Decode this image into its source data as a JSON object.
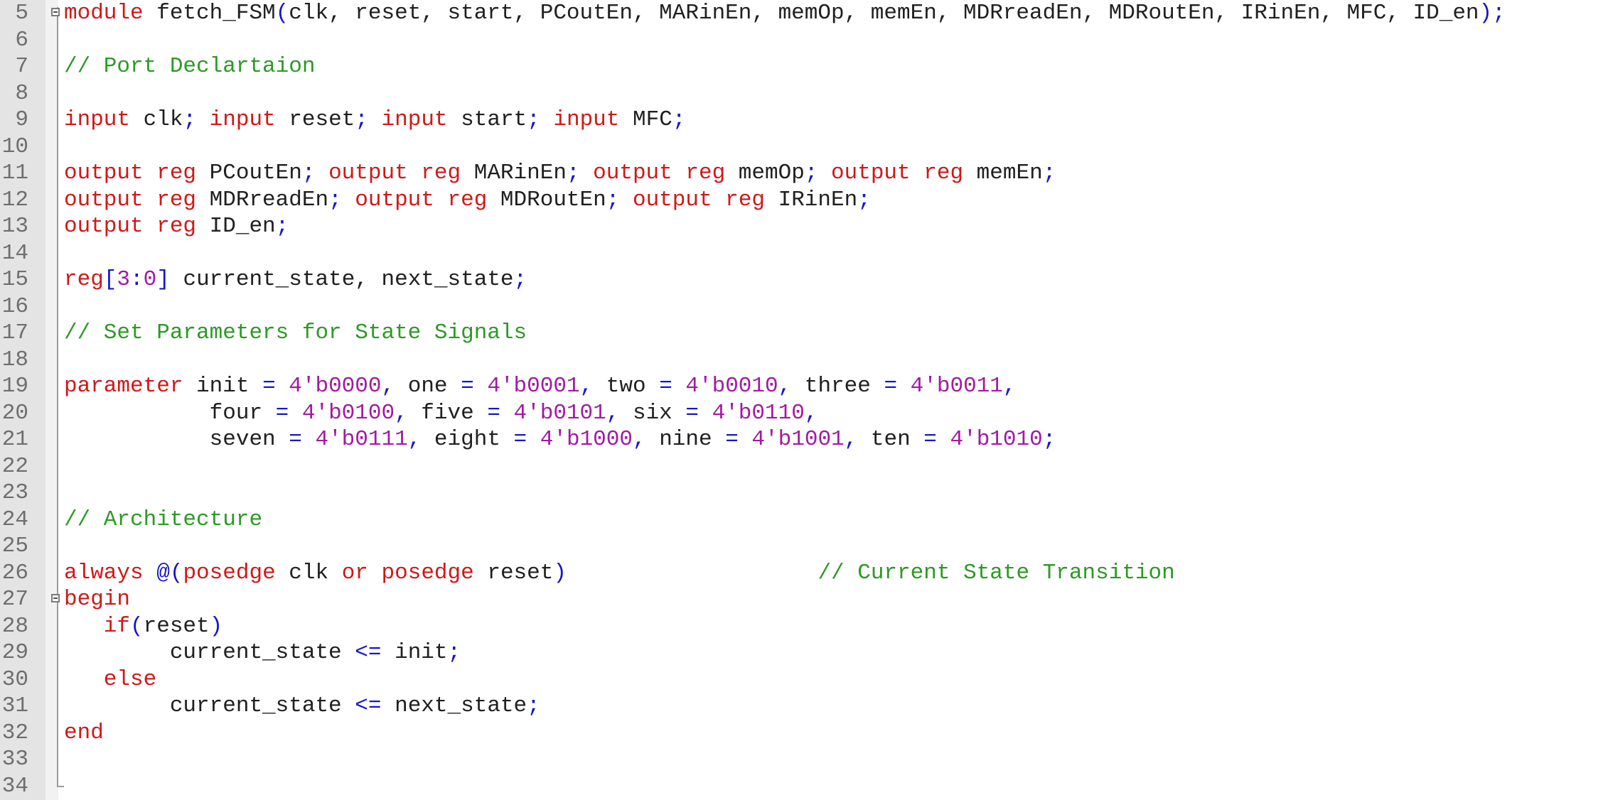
{
  "editor": {
    "language": "verilog",
    "lines": [
      {
        "n": "5",
        "fold": "open",
        "tokens": [
          {
            "t": "module",
            "c": "kw"
          },
          {
            "t": " fetch_FSM",
            "c": "id"
          },
          {
            "t": "(",
            "c": "op"
          },
          {
            "t": "clk, reset, start, PCoutEn, MARinEn, memOp, memEn, MDRreadEn, MDRoutEn, IRinEn, MFC, ID_en",
            "c": "id"
          },
          {
            "t": ");",
            "c": "op"
          }
        ]
      },
      {
        "n": "6",
        "tokens": []
      },
      {
        "n": "7",
        "tokens": [
          {
            "t": "// Port Declartaion",
            "c": "cm"
          }
        ]
      },
      {
        "n": "8",
        "tokens": []
      },
      {
        "n": "9",
        "tokens": [
          {
            "t": "input",
            "c": "kw"
          },
          {
            "t": " clk",
            "c": "id"
          },
          {
            "t": ";",
            "c": "op"
          },
          {
            "t": " input",
            "c": "kw"
          },
          {
            "t": " reset",
            "c": "id"
          },
          {
            "t": ";",
            "c": "op"
          },
          {
            "t": " input",
            "c": "kw"
          },
          {
            "t": " start",
            "c": "id"
          },
          {
            "t": ";",
            "c": "op"
          },
          {
            "t": " input",
            "c": "kw"
          },
          {
            "t": " MFC",
            "c": "id"
          },
          {
            "t": ";",
            "c": "op"
          }
        ]
      },
      {
        "n": "10",
        "tokens": []
      },
      {
        "n": "11",
        "tokens": [
          {
            "t": "output reg",
            "c": "kw"
          },
          {
            "t": " PCoutEn",
            "c": "id"
          },
          {
            "t": ";",
            "c": "op"
          },
          {
            "t": " output reg",
            "c": "kw"
          },
          {
            "t": " MARinEn",
            "c": "id"
          },
          {
            "t": ";",
            "c": "op"
          },
          {
            "t": " output reg",
            "c": "kw"
          },
          {
            "t": " memOp",
            "c": "id"
          },
          {
            "t": ";",
            "c": "op"
          },
          {
            "t": " output reg",
            "c": "kw"
          },
          {
            "t": " memEn",
            "c": "id"
          },
          {
            "t": ";",
            "c": "op"
          }
        ]
      },
      {
        "n": "12",
        "tokens": [
          {
            "t": "output reg",
            "c": "kw"
          },
          {
            "t": " MDRreadEn",
            "c": "id"
          },
          {
            "t": ";",
            "c": "op"
          },
          {
            "t": " output reg",
            "c": "kw"
          },
          {
            "t": " MDRoutEn",
            "c": "id"
          },
          {
            "t": ";",
            "c": "op"
          },
          {
            "t": " output reg",
            "c": "kw"
          },
          {
            "t": " IRinEn",
            "c": "id"
          },
          {
            "t": ";",
            "c": "op"
          }
        ]
      },
      {
        "n": "13",
        "tokens": [
          {
            "t": "output reg",
            "c": "kw"
          },
          {
            "t": " ID_en",
            "c": "id"
          },
          {
            "t": ";",
            "c": "op"
          }
        ]
      },
      {
        "n": "14",
        "tokens": []
      },
      {
        "n": "15",
        "tokens": [
          {
            "t": "reg",
            "c": "kw"
          },
          {
            "t": "[",
            "c": "op"
          },
          {
            "t": "3",
            "c": "num"
          },
          {
            "t": ":",
            "c": "op"
          },
          {
            "t": "0",
            "c": "num"
          },
          {
            "t": "]",
            "c": "op"
          },
          {
            "t": " current_state, next_state",
            "c": "id"
          },
          {
            "t": ";",
            "c": "op"
          }
        ]
      },
      {
        "n": "16",
        "tokens": []
      },
      {
        "n": "17",
        "tokens": [
          {
            "t": "// Set Parameters for State Signals",
            "c": "cm"
          }
        ]
      },
      {
        "n": "18",
        "tokens": []
      },
      {
        "n": "19",
        "tokens": [
          {
            "t": "parameter",
            "c": "kw"
          },
          {
            "t": " init ",
            "c": "id"
          },
          {
            "t": "=",
            "c": "op"
          },
          {
            "t": " 4'b0000",
            "c": "num"
          },
          {
            "t": ",",
            "c": "op"
          },
          {
            "t": " one ",
            "c": "id"
          },
          {
            "t": "=",
            "c": "op"
          },
          {
            "t": " 4'b0001",
            "c": "num"
          },
          {
            "t": ",",
            "c": "op"
          },
          {
            "t": " two ",
            "c": "id"
          },
          {
            "t": "=",
            "c": "op"
          },
          {
            "t": " 4'b0010",
            "c": "num"
          },
          {
            "t": ",",
            "c": "op"
          },
          {
            "t": " three ",
            "c": "id"
          },
          {
            "t": "=",
            "c": "op"
          },
          {
            "t": " 4'b0011",
            "c": "num"
          },
          {
            "t": ",",
            "c": "op"
          }
        ]
      },
      {
        "n": "20",
        "tokens": [
          {
            "t": "           four ",
            "c": "id"
          },
          {
            "t": "=",
            "c": "op"
          },
          {
            "t": " 4'b0100",
            "c": "num"
          },
          {
            "t": ",",
            "c": "op"
          },
          {
            "t": " five ",
            "c": "id"
          },
          {
            "t": "=",
            "c": "op"
          },
          {
            "t": " 4'b0101",
            "c": "num"
          },
          {
            "t": ",",
            "c": "op"
          },
          {
            "t": " six ",
            "c": "id"
          },
          {
            "t": "=",
            "c": "op"
          },
          {
            "t": " 4'b0110",
            "c": "num"
          },
          {
            "t": ",",
            "c": "op"
          }
        ]
      },
      {
        "n": "21",
        "tokens": [
          {
            "t": "           seven ",
            "c": "id"
          },
          {
            "t": "=",
            "c": "op"
          },
          {
            "t": " 4'b0111",
            "c": "num"
          },
          {
            "t": ",",
            "c": "op"
          },
          {
            "t": " eight ",
            "c": "id"
          },
          {
            "t": "=",
            "c": "op"
          },
          {
            "t": " 4'b1000",
            "c": "num"
          },
          {
            "t": ",",
            "c": "op"
          },
          {
            "t": " nine ",
            "c": "id"
          },
          {
            "t": "=",
            "c": "op"
          },
          {
            "t": " 4'b1001",
            "c": "num"
          },
          {
            "t": ",",
            "c": "op"
          },
          {
            "t": " ten ",
            "c": "id"
          },
          {
            "t": "=",
            "c": "op"
          },
          {
            "t": " 4'b1010",
            "c": "num"
          },
          {
            "t": ";",
            "c": "op"
          }
        ]
      },
      {
        "n": "22",
        "tokens": []
      },
      {
        "n": "23",
        "tokens": []
      },
      {
        "n": "24",
        "tokens": [
          {
            "t": "// Architecture",
            "c": "cm"
          }
        ]
      },
      {
        "n": "25",
        "tokens": []
      },
      {
        "n": "26",
        "tokens": [
          {
            "t": "always",
            "c": "kw"
          },
          {
            "t": " @",
            "c": "op"
          },
          {
            "t": "(",
            "c": "op"
          },
          {
            "t": "posedge",
            "c": "kw"
          },
          {
            "t": " clk ",
            "c": "id"
          },
          {
            "t": "or",
            "c": "kw"
          },
          {
            "t": " posedge",
            "c": "kw"
          },
          {
            "t": " reset",
            "c": "id"
          },
          {
            "t": ")",
            "c": "op"
          },
          {
            "t": "                   ",
            "c": "id"
          },
          {
            "t": "// Current State Transition",
            "c": "cm"
          }
        ]
      },
      {
        "n": "27",
        "fold": "open",
        "tokens": [
          {
            "t": "begin",
            "c": "kw"
          }
        ]
      },
      {
        "n": "28",
        "tokens": [
          {
            "t": "   if",
            "c": "kw"
          },
          {
            "t": "(",
            "c": "op"
          },
          {
            "t": "reset",
            "c": "id"
          },
          {
            "t": ")",
            "c": "op"
          }
        ]
      },
      {
        "n": "29",
        "tokens": [
          {
            "t": "        current_state ",
            "c": "id"
          },
          {
            "t": "<=",
            "c": "op"
          },
          {
            "t": " init",
            "c": "id"
          },
          {
            "t": ";",
            "c": "op"
          }
        ]
      },
      {
        "n": "30",
        "tokens": [
          {
            "t": "   else",
            "c": "kw"
          }
        ]
      },
      {
        "n": "31",
        "tokens": [
          {
            "t": "        current_state ",
            "c": "id"
          },
          {
            "t": "<=",
            "c": "op"
          },
          {
            "t": " next_state",
            "c": "id"
          },
          {
            "t": ";",
            "c": "op"
          }
        ]
      },
      {
        "n": "32",
        "fold": "end",
        "tokens": [
          {
            "t": "end",
            "c": "kw"
          }
        ]
      },
      {
        "n": "33",
        "tokens": []
      },
      {
        "n": "34",
        "fold": "tail",
        "tokens": []
      }
    ]
  },
  "colors": {
    "keyword": "#d01818",
    "comment": "#2b9a24",
    "operator": "#1616c8",
    "number": "#a21aa2",
    "identifier": "#202020",
    "line_number": "#6e6e6e",
    "gutter": "#e4e4e4"
  }
}
